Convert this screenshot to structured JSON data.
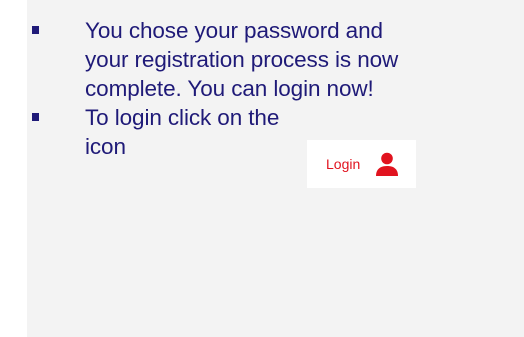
{
  "bullets": [
    {
      "lines": [
        "You chose your password and",
        "your registration process is now",
        "complete. You can login now!"
      ]
    },
    {
      "lines": [
        "To login click on the",
        "icon"
      ]
    }
  ],
  "login_button": {
    "label": "Login",
    "icon": "user-icon"
  },
  "colors": {
    "text": "#1f1a78",
    "bullet": "#1f1a78",
    "panel_background": "#f3f3f3",
    "login_accent": "#e1131f"
  }
}
